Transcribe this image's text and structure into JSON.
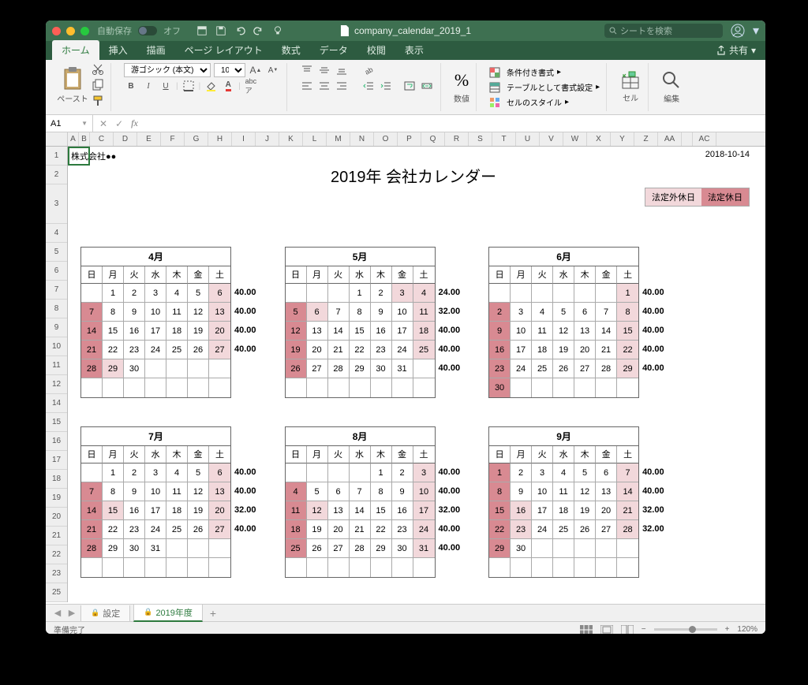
{
  "window": {
    "autosave": "自動保存",
    "autosave_state": "オフ",
    "filename": "company_calendar_2019_1",
    "search_placeholder": "シートを検索"
  },
  "tabs": {
    "items": [
      "ホーム",
      "挿入",
      "描画",
      "ページ レイアウト",
      "数式",
      "データ",
      "校閲",
      "表示"
    ],
    "active": 0,
    "share": "共有"
  },
  "ribbon": {
    "paste": "ペースト",
    "font_name": "游ゴシック (本文)",
    "font_size": "10",
    "number_group": "数値",
    "cond_fmt": "条件付き書式",
    "table_fmt": "テーブルとして書式設定",
    "cell_styles": "セルのスタイル",
    "cell_group": "セル",
    "edit_group": "編集"
  },
  "formula": {
    "cell_ref": "A1",
    "fx": "fx"
  },
  "columns": [
    "A",
    "B",
    "C",
    "D",
    "E",
    "F",
    "G",
    "H",
    "I",
    "J",
    "K",
    "L",
    "M",
    "N",
    "O",
    "P",
    "Q",
    "R",
    "S",
    "T",
    "U",
    "V",
    "W",
    "X",
    "Y",
    "Z",
    "AA",
    "",
    "AC"
  ],
  "rows": [
    "1",
    "2",
    "3",
    "4",
    "5",
    "6",
    "7",
    "8",
    "9",
    "10",
    "11",
    "12",
    "14",
    "15",
    "16",
    "17",
    "18",
    "19",
    "20",
    "21",
    "22",
    "23",
    "25"
  ],
  "doc": {
    "company": "株式会社●●",
    "date": "2018-10-14",
    "title": "2019年 会社カレンダー",
    "legend1": "法定外休日",
    "legend2": "法定休日"
  },
  "weekdays": [
    "日",
    "月",
    "火",
    "水",
    "木",
    "金",
    "土"
  ],
  "calendars": [
    {
      "title": "4月",
      "rows": [
        [
          "",
          "1",
          "2",
          "3",
          "4",
          "5",
          "6"
        ],
        [
          "7",
          "8",
          "9",
          "10",
          "11",
          "12",
          "13"
        ],
        [
          "14",
          "15",
          "16",
          "17",
          "18",
          "19",
          "20"
        ],
        [
          "21",
          "22",
          "23",
          "24",
          "25",
          "26",
          "27"
        ],
        [
          "28",
          "29",
          "30",
          "",
          "",
          "",
          ""
        ],
        [
          "",
          "",
          "",
          "",
          "",
          "",
          ""
        ]
      ],
      "styles": [
        [
          "",
          "",
          "",
          "",
          "",
          "",
          "pink"
        ],
        [
          "red",
          "",
          "",
          "",
          "",
          "",
          "pink"
        ],
        [
          "red",
          "",
          "",
          "",
          "",
          "",
          "pink"
        ],
        [
          "red",
          "",
          "",
          "",
          "",
          "",
          "pink"
        ],
        [
          "red",
          "pink",
          "",
          "",
          "",
          "",
          ""
        ],
        [
          "",
          "",
          "",
          "",
          "",
          "",
          ""
        ]
      ],
      "hours": [
        "40.00",
        "40.00",
        "40.00",
        "40.00",
        "",
        ""
      ]
    },
    {
      "title": "5月",
      "rows": [
        [
          "",
          "",
          "",
          "1",
          "2",
          "3",
          "4"
        ],
        [
          "5",
          "6",
          "7",
          "8",
          "9",
          "10",
          "11"
        ],
        [
          "12",
          "13",
          "14",
          "15",
          "16",
          "17",
          "18"
        ],
        [
          "19",
          "20",
          "21",
          "22",
          "23",
          "24",
          "25"
        ],
        [
          "26",
          "27",
          "28",
          "29",
          "30",
          "31",
          ""
        ],
        [
          "",
          "",
          "",
          "",
          "",
          "",
          ""
        ]
      ],
      "styles": [
        [
          "",
          "",
          "",
          "",
          "",
          "pink",
          "pink"
        ],
        [
          "red",
          "pink",
          "",
          "",
          "",
          "",
          "pink"
        ],
        [
          "red",
          "",
          "",
          "",
          "",
          "",
          "pink"
        ],
        [
          "red",
          "",
          "",
          "",
          "",
          "",
          "pink"
        ],
        [
          "red",
          "",
          "",
          "",
          "",
          "",
          ""
        ],
        [
          "",
          "",
          "",
          "",
          "",
          "",
          ""
        ]
      ],
      "hours": [
        "24.00",
        "32.00",
        "40.00",
        "40.00",
        "40.00",
        ""
      ]
    },
    {
      "title": "6月",
      "rows": [
        [
          "",
          "",
          "",
          "",
          "",
          "",
          "1"
        ],
        [
          "2",
          "3",
          "4",
          "5",
          "6",
          "7",
          "8"
        ],
        [
          "9",
          "10",
          "11",
          "12",
          "13",
          "14",
          "15"
        ],
        [
          "16",
          "17",
          "18",
          "19",
          "20",
          "21",
          "22"
        ],
        [
          "23",
          "24",
          "25",
          "26",
          "27",
          "28",
          "29"
        ],
        [
          "30",
          "",
          "",
          "",
          "",
          "",
          ""
        ]
      ],
      "styles": [
        [
          "",
          "",
          "",
          "",
          "",
          "",
          "pink"
        ],
        [
          "red",
          "",
          "",
          "",
          "",
          "",
          "pink"
        ],
        [
          "red",
          "",
          "",
          "",
          "",
          "",
          "pink"
        ],
        [
          "red",
          "",
          "",
          "",
          "",
          "",
          "pink"
        ],
        [
          "red",
          "",
          "",
          "",
          "",
          "",
          "pink"
        ],
        [
          "red",
          "",
          "",
          "",
          "",
          "",
          ""
        ]
      ],
      "hours": [
        "40.00",
        "40.00",
        "40.00",
        "40.00",
        "40.00",
        ""
      ]
    },
    {
      "title": "7月",
      "rows": [
        [
          "",
          "1",
          "2",
          "3",
          "4",
          "5",
          "6"
        ],
        [
          "7",
          "8",
          "9",
          "10",
          "11",
          "12",
          "13"
        ],
        [
          "14",
          "15",
          "16",
          "17",
          "18",
          "19",
          "20"
        ],
        [
          "21",
          "22",
          "23",
          "24",
          "25",
          "26",
          "27"
        ],
        [
          "28",
          "29",
          "30",
          "31",
          "",
          "",
          ""
        ],
        [
          "",
          "",
          "",
          "",
          "",
          "",
          ""
        ]
      ],
      "styles": [
        [
          "",
          "",
          "",
          "",
          "",
          "",
          "pink"
        ],
        [
          "red",
          "",
          "",
          "",
          "",
          "",
          "pink"
        ],
        [
          "red",
          "pink",
          "",
          "",
          "",
          "",
          "pink"
        ],
        [
          "red",
          "",
          "",
          "",
          "",
          "",
          "pink"
        ],
        [
          "red",
          "",
          "",
          "",
          "",
          "",
          ""
        ],
        [
          "",
          "",
          "",
          "",
          "",
          "",
          ""
        ]
      ],
      "hours": [
        "40.00",
        "40.00",
        "32.00",
        "40.00",
        "",
        ""
      ]
    },
    {
      "title": "8月",
      "rows": [
        [
          "",
          "",
          "",
          "",
          "1",
          "2",
          "3"
        ],
        [
          "4",
          "5",
          "6",
          "7",
          "8",
          "9",
          "10"
        ],
        [
          "11",
          "12",
          "13",
          "14",
          "15",
          "16",
          "17"
        ],
        [
          "18",
          "19",
          "20",
          "21",
          "22",
          "23",
          "24"
        ],
        [
          "25",
          "26",
          "27",
          "28",
          "29",
          "30",
          "31"
        ],
        [
          "",
          "",
          "",
          "",
          "",
          "",
          ""
        ]
      ],
      "styles": [
        [
          "",
          "",
          "",
          "",
          "",
          "",
          "pink"
        ],
        [
          "red",
          "",
          "",
          "",
          "",
          "",
          "pink"
        ],
        [
          "red",
          "pink",
          "",
          "",
          "",
          "",
          "pink"
        ],
        [
          "red",
          "",
          "",
          "",
          "",
          "",
          "pink"
        ],
        [
          "red",
          "",
          "",
          "",
          "",
          "",
          "pink"
        ],
        [
          "",
          "",
          "",
          "",
          "",
          "",
          ""
        ]
      ],
      "hours": [
        "40.00",
        "40.00",
        "32.00",
        "40.00",
        "40.00",
        ""
      ]
    },
    {
      "title": "9月",
      "rows": [
        [
          "1",
          "2",
          "3",
          "4",
          "5",
          "6",
          "7"
        ],
        [
          "8",
          "9",
          "10",
          "11",
          "12",
          "13",
          "14"
        ],
        [
          "15",
          "16",
          "17",
          "18",
          "19",
          "20",
          "21"
        ],
        [
          "22",
          "23",
          "24",
          "25",
          "26",
          "27",
          "28"
        ],
        [
          "29",
          "30",
          "",
          "",
          "",
          "",
          ""
        ],
        [
          "",
          "",
          "",
          "",
          "",
          "",
          ""
        ]
      ],
      "styles": [
        [
          "red",
          "",
          "",
          "",
          "",
          "",
          "pink"
        ],
        [
          "red",
          "",
          "",
          "",
          "",
          "",
          "pink"
        ],
        [
          "red",
          "pink",
          "",
          "",
          "",
          "",
          "pink"
        ],
        [
          "red",
          "pink",
          "",
          "",
          "",
          "",
          "pink"
        ],
        [
          "red",
          "",
          "",
          "",
          "",
          "",
          ""
        ],
        [
          "",
          "",
          "",
          "",
          "",
          "",
          ""
        ]
      ],
      "hours": [
        "40.00",
        "40.00",
        "32.00",
        "32.00",
        "",
        ""
      ]
    }
  ],
  "sheet_tabs": {
    "tab1": "設定",
    "tab2": "2019年度"
  },
  "status": {
    "ready": "準備完了",
    "zoom": "120%"
  }
}
